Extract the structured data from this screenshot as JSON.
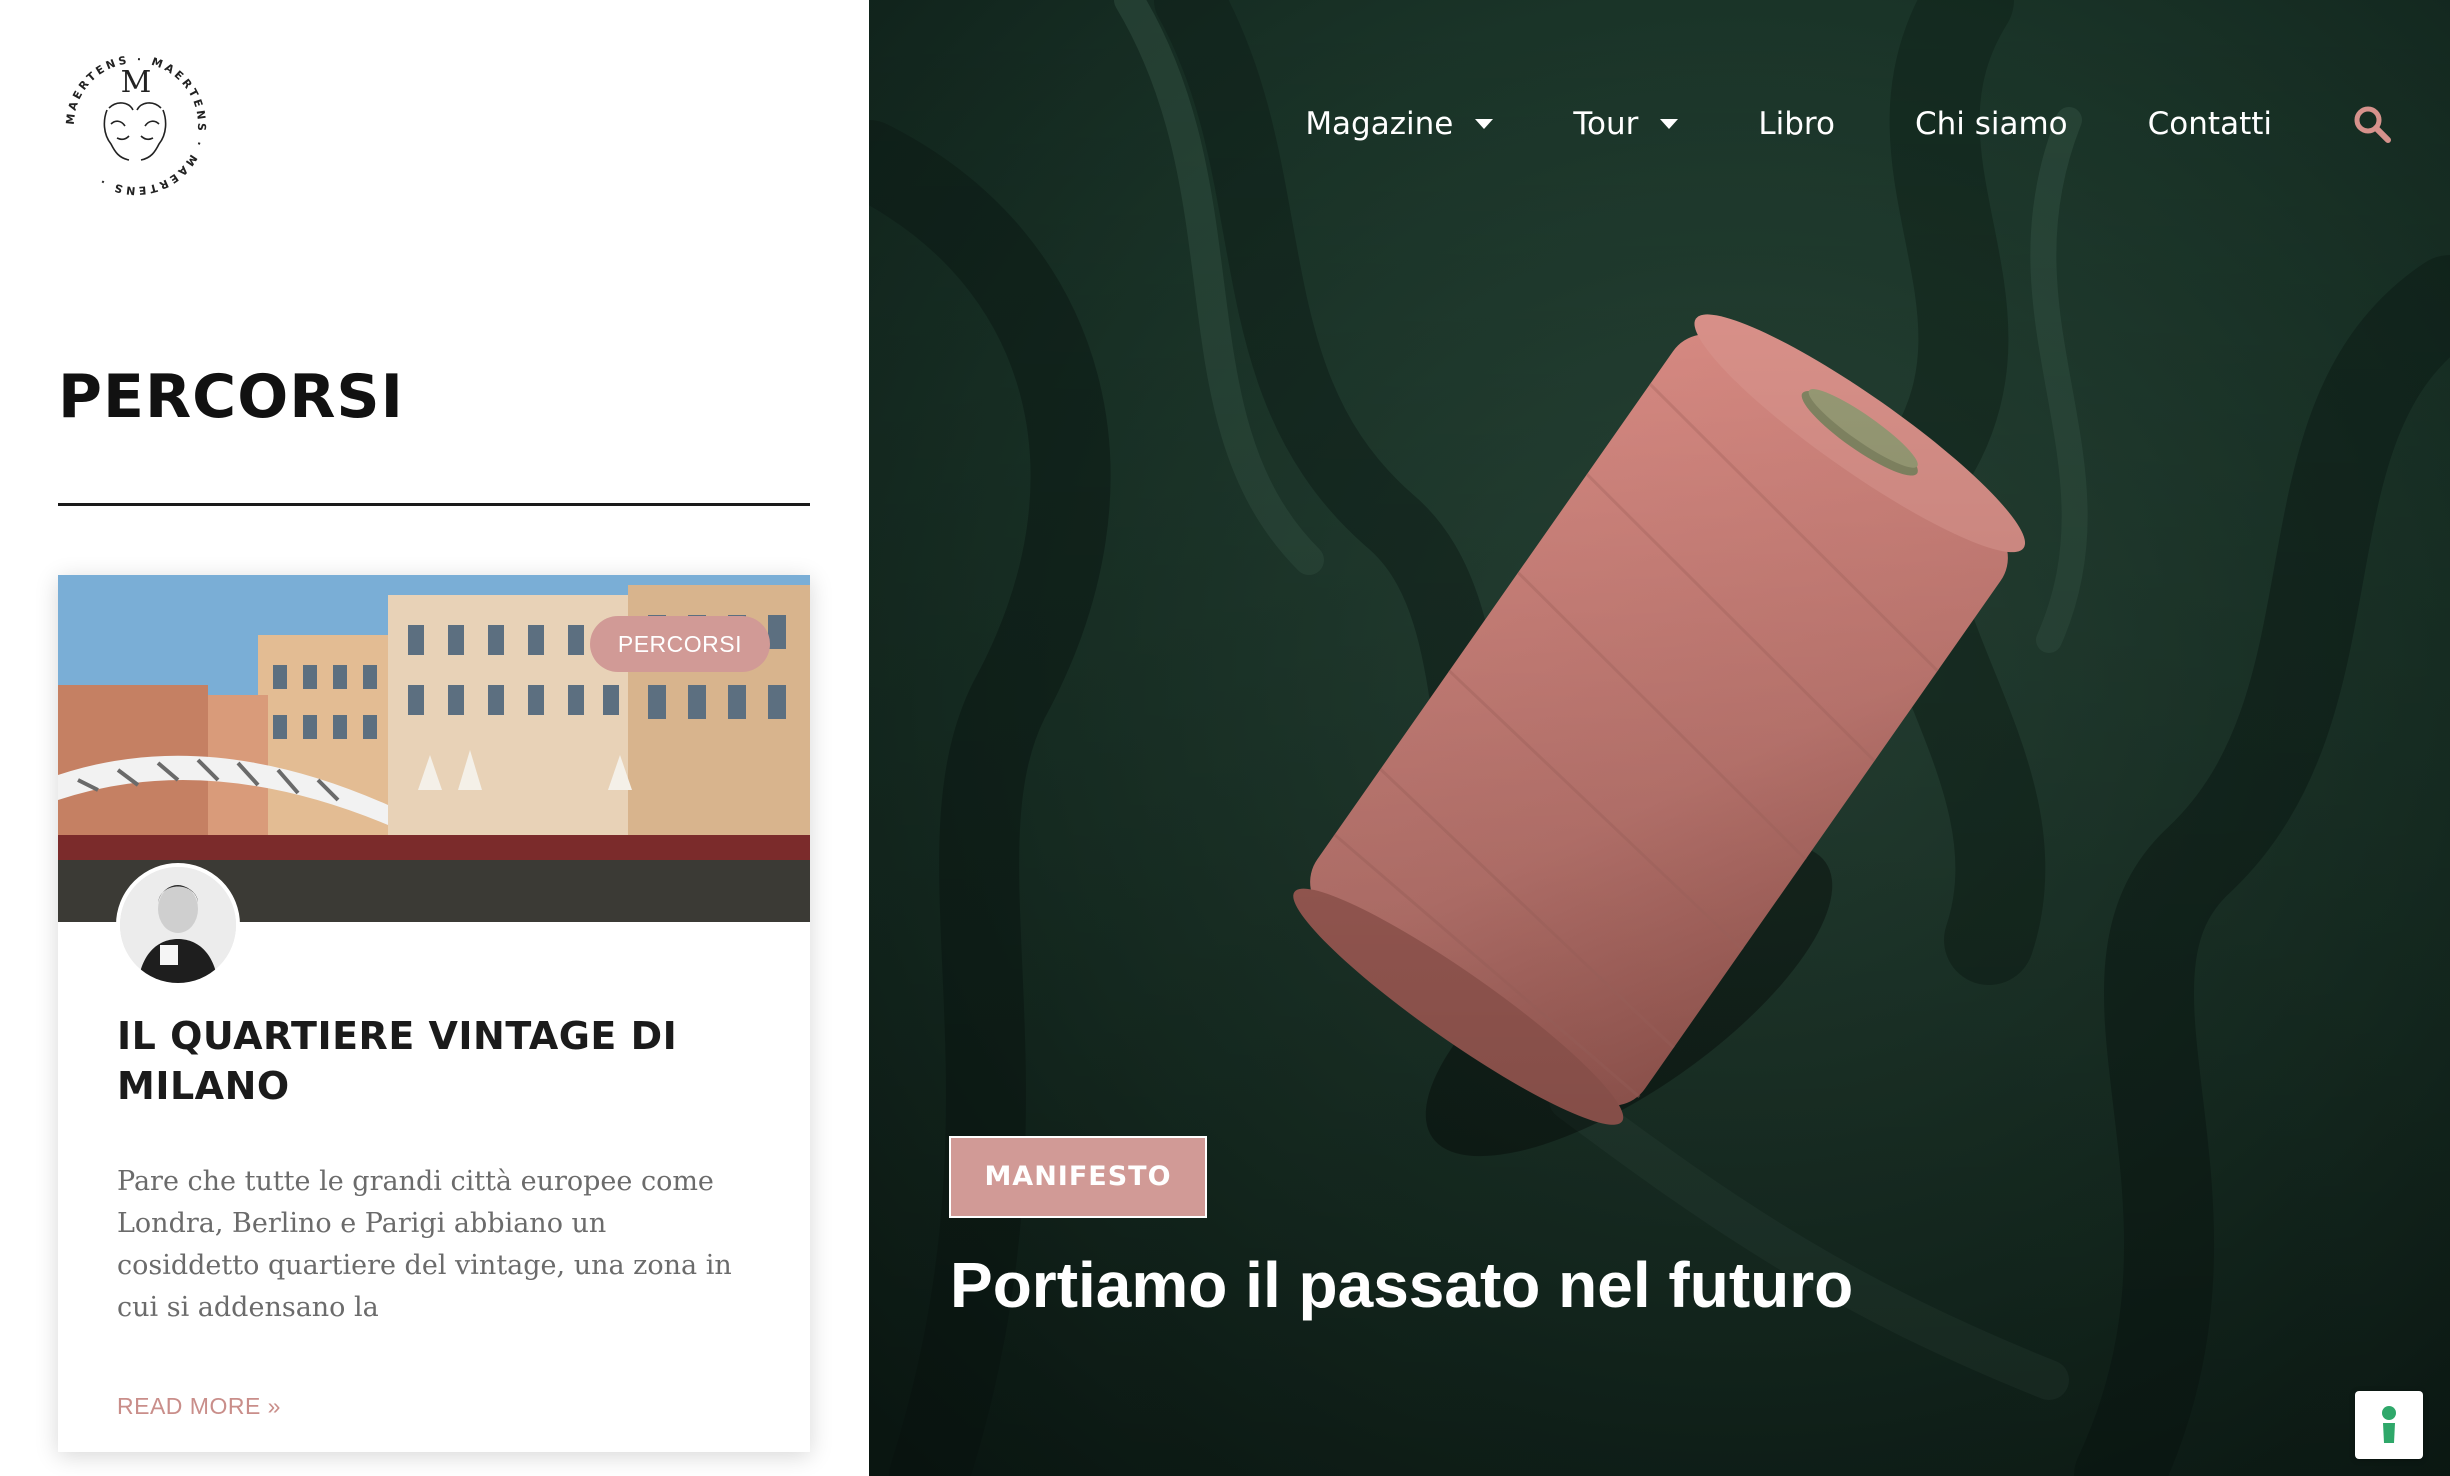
{
  "brand": {
    "logo_letter": "M",
    "logo_ring_text": "MAERTENS · MAERTENS · MAERTENS ·"
  },
  "left": {
    "section_title": "PERCORSI",
    "card": {
      "badge": "PERCORSI",
      "title": "IL QUARTIERE VINTAGE DI MILANO",
      "excerpt": "Pare che tutte le grandi città europee come Londra, Berlino e Parigi abbiano un cosiddetto quartiere del vintage, una zona in cui si addensano la",
      "read_more": "READ MORE »"
    }
  },
  "nav": {
    "items": [
      {
        "label": "Magazine",
        "has_dropdown": true
      },
      {
        "label": "Tour",
        "has_dropdown": true
      },
      {
        "label": "Libro",
        "has_dropdown": false
      },
      {
        "label": "Chi siamo",
        "has_dropdown": false
      },
      {
        "label": "Contatti",
        "has_dropdown": false
      }
    ],
    "search_icon": "search-icon"
  },
  "hero": {
    "tag": "MANIFESTO",
    "title": "Portiamo il passato nel futuro"
  },
  "colors": {
    "accent_pink": "#d19a96",
    "hero_green": "#173226",
    "text_dark": "#1b1b1b",
    "excerpt_grey": "#6b6b6b",
    "search_pink": "#d6928c"
  }
}
